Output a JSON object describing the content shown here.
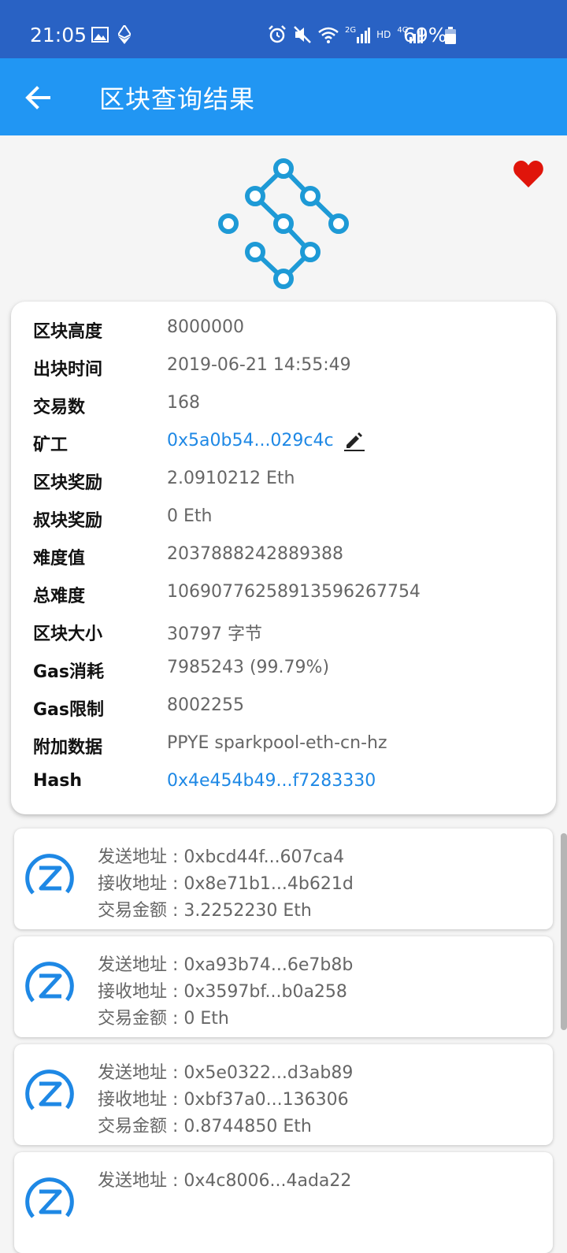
{
  "status_bar": {
    "time": "21:05",
    "battery": "69%",
    "icons": [
      "image-icon",
      "ethereum-icon",
      "alarm-icon",
      "mute-icon",
      "wifi-icon",
      "signal-2g-icon",
      "hd-icon",
      "signal-4g-icon",
      "battery-icon"
    ],
    "net_2g": "2G",
    "net_hd": "HD",
    "net_4g": "4G"
  },
  "app_bar": {
    "title": "区块查询结果",
    "back_icon": "arrow-left-icon",
    "color": "#2196f3"
  },
  "status_color": "#2962c4",
  "favorite_color": "#e0150b",
  "block": {
    "rows": [
      {
        "label": "区块高度",
        "value": "8000000"
      },
      {
        "label": "出块时间",
        "value": "2019-06-21 14:55:49"
      },
      {
        "label": "交易数",
        "value": "168"
      },
      {
        "label": "矿工",
        "value": "0x5a0b54...029c4c"
      },
      {
        "label": "区块奖励",
        "value": "2.0910212 Eth"
      },
      {
        "label": "叔块奖励",
        "value": "0 Eth"
      },
      {
        "label": "难度值",
        "value": "2037888242889388"
      },
      {
        "label": "总难度",
        "value": "10690776258913596267754"
      },
      {
        "label": "区块大小",
        "value": "30797 字节"
      },
      {
        "label": "Gas消耗",
        "value": "7985243 (99.79%)"
      },
      {
        "label": "Gas限制",
        "value": "8002255"
      },
      {
        "label": "附加数据",
        "value": "PPYE sparkpool-eth-cn-hz"
      },
      {
        "label": "Hash",
        "value": "0x4e454b49...f7283330"
      }
    ]
  },
  "transactions": [
    {
      "from": "发送地址 : 0xbcd44f...607ca4",
      "to": "接收地址 : 0x8e71b1...4b621d",
      "amount": "交易金额 : 3.2252230 Eth"
    },
    {
      "from": "发送地址 : 0xa93b74...6e7b8b",
      "to": "接收地址 : 0x3597bf...b0a258",
      "amount": "交易金额 : 0 Eth"
    },
    {
      "from": "发送地址 : 0x5e0322...d3ab89",
      "to": "接收地址 : 0xbf37a0...136306",
      "amount": "交易金额 : 0.8744850 Eth"
    },
    {
      "from": "发送地址 : 0x4c8006...4ada22",
      "to": "",
      "amount": ""
    }
  ]
}
